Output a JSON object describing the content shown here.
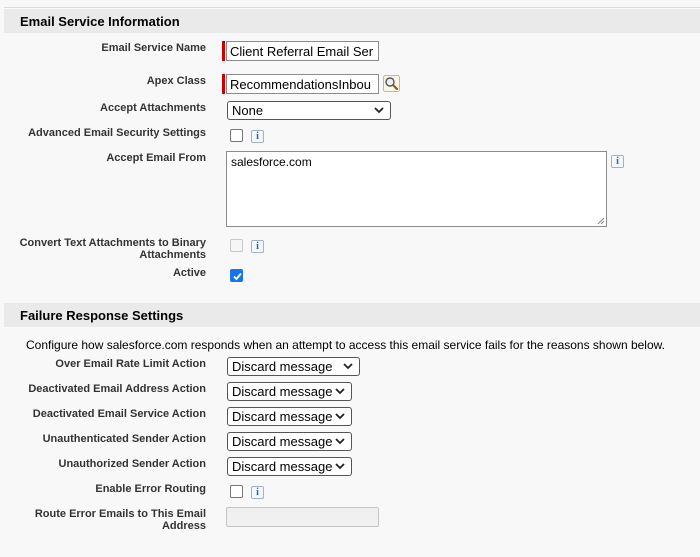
{
  "email_service_section": {
    "title": "Email Service Information",
    "email_service_name": {
      "label": "Email Service Name",
      "value": "Client Referral Email Ser"
    },
    "apex_class": {
      "label": "Apex Class",
      "value": "RecommendationsInbou"
    },
    "accept_attachments": {
      "label": "Accept Attachments",
      "selected": "None"
    },
    "advanced_security": {
      "label": "Advanced Email Security Settings",
      "checked": false
    },
    "accept_email_from": {
      "label": "Accept Email From",
      "value": "salesforce.com"
    },
    "convert_text_attachments": {
      "label_line1": "Convert Text Attachments to Binary",
      "label_line2": "Attachments",
      "checked": false,
      "disabled": true
    },
    "active": {
      "label": "Active",
      "checked": true
    }
  },
  "failure_section": {
    "title": "Failure Response Settings",
    "description": "Configure how salesforce.com responds when an attempt to access this email service fails for the reasons shown below.",
    "over_rate_limit": {
      "label": "Over Email Rate Limit Action",
      "selected": "Discard message"
    },
    "deactivated_address": {
      "label": "Deactivated Email Address Action",
      "selected": "Discard message"
    },
    "deactivated_service": {
      "label": "Deactivated Email Service Action",
      "selected": "Discard message"
    },
    "unauthenticated_sender": {
      "label": "Unauthenticated Sender Action",
      "selected": "Discard message"
    },
    "unauthorized_sender": {
      "label": "Unauthorized Sender Action",
      "selected": "Discard message"
    },
    "enable_error_routing": {
      "label": "Enable Error Routing",
      "checked": false
    },
    "route_error_emails": {
      "label_line1": "Route Error Emails to This Email",
      "label_line2": "Address",
      "value": ""
    }
  },
  "icons": {
    "info": "info-icon",
    "lookup": "lookup-magnifier-icon",
    "dropdown": "chevron-down-icon",
    "check": "checkmark-icon"
  },
  "info_glyph": "i",
  "colors": {
    "required_bar": "#cc0000",
    "section_header_bg": "#eaeaea",
    "checkbox_checked": "#1a73e8"
  }
}
